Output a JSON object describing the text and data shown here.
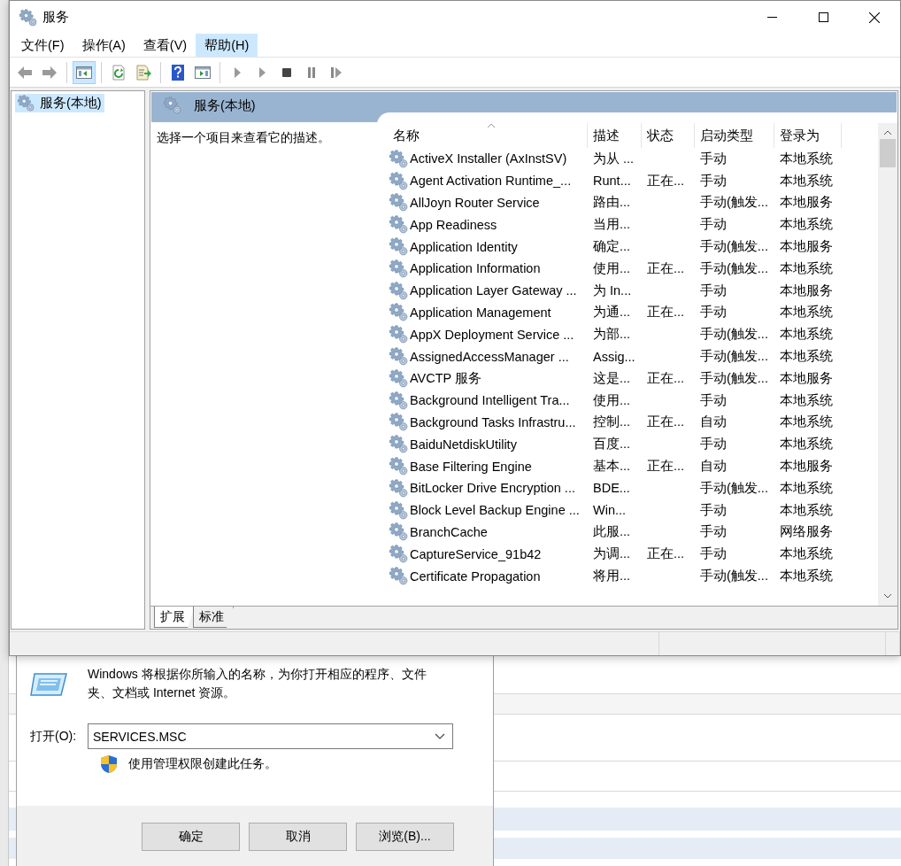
{
  "window": {
    "title": "服务"
  },
  "menu": [
    {
      "label": "文件(F)",
      "selected": false
    },
    {
      "label": "操作(A)",
      "selected": false
    },
    {
      "label": "查看(V)",
      "selected": false
    },
    {
      "label": "帮助(H)",
      "selected": true
    }
  ],
  "toolbar": [
    {
      "kind": "back",
      "selected": false
    },
    {
      "kind": "forward",
      "selected": false
    },
    {
      "kind": "separator"
    },
    {
      "kind": "console_tree",
      "selected": true
    },
    {
      "kind": "separator"
    },
    {
      "kind": "refresh",
      "selected": false
    },
    {
      "kind": "export",
      "selected": false
    },
    {
      "kind": "separator"
    },
    {
      "kind": "help",
      "selected": false
    },
    {
      "kind": "action_pane",
      "selected": false
    },
    {
      "kind": "separator"
    },
    {
      "kind": "start",
      "selected": false
    },
    {
      "kind": "start",
      "selected": false
    },
    {
      "kind": "stop",
      "selected": false
    },
    {
      "kind": "pause",
      "selected": false
    },
    {
      "kind": "restart",
      "selected": false
    }
  ],
  "tree": [
    {
      "label": "服务(本地)",
      "selected": true
    }
  ],
  "panel": {
    "title": "服务(本地)",
    "description": "选择一个项目来查看它的描述。"
  },
  "table": {
    "columns": [
      {
        "label": "名称",
        "sorted": true
      },
      {
        "label": "描述",
        "sorted": false
      },
      {
        "label": "状态",
        "sorted": false
      },
      {
        "label": "启动类型",
        "sorted": false
      },
      {
        "label": "登录为",
        "sorted": false
      }
    ],
    "rows": [
      {
        "name": "ActiveX Installer (AxInstSV)",
        "description": "为从 ...",
        "status": "",
        "startup_type": "手动",
        "log_on_as": "本地系统"
      },
      {
        "name": "Agent Activation Runtime_...",
        "description": "Runt...",
        "status": "正在...",
        "startup_type": "手动",
        "log_on_as": "本地系统"
      },
      {
        "name": "AllJoyn Router Service",
        "description": "路由...",
        "status": "",
        "startup_type": "手动(触发...",
        "log_on_as": "本地服务"
      },
      {
        "name": "App Readiness",
        "description": "当用...",
        "status": "",
        "startup_type": "手动",
        "log_on_as": "本地系统"
      },
      {
        "name": "Application Identity",
        "description": "确定...",
        "status": "",
        "startup_type": "手动(触发...",
        "log_on_as": "本地服务"
      },
      {
        "name": "Application Information",
        "description": "使用...",
        "status": "正在...",
        "startup_type": "手动(触发...",
        "log_on_as": "本地系统"
      },
      {
        "name": "Application Layer Gateway ...",
        "description": "为 In...",
        "status": "",
        "startup_type": "手动",
        "log_on_as": "本地服务"
      },
      {
        "name": "Application Management",
        "description": "为通...",
        "status": "正在...",
        "startup_type": "手动",
        "log_on_as": "本地系统"
      },
      {
        "name": "AppX Deployment Service ...",
        "description": "为部...",
        "status": "",
        "startup_type": "手动(触发...",
        "log_on_as": "本地系统"
      },
      {
        "name": "AssignedAccessManager ...",
        "description": "Assig...",
        "status": "",
        "startup_type": "手动(触发...",
        "log_on_as": "本地系统"
      },
      {
        "name": "AVCTP 服务",
        "description": "这是...",
        "status": "正在...",
        "startup_type": "手动(触发...",
        "log_on_as": "本地服务"
      },
      {
        "name": "Background Intelligent Tra...",
        "description": "使用...",
        "status": "",
        "startup_type": "手动",
        "log_on_as": "本地系统"
      },
      {
        "name": "Background Tasks Infrastru...",
        "description": "控制...",
        "status": "正在...",
        "startup_type": "自动",
        "log_on_as": "本地系统"
      },
      {
        "name": "BaiduNetdiskUtility",
        "description": "百度...",
        "status": "",
        "startup_type": "手动",
        "log_on_as": "本地系统"
      },
      {
        "name": "Base Filtering Engine",
        "description": "基本...",
        "status": "正在...",
        "startup_type": "自动",
        "log_on_as": "本地服务"
      },
      {
        "name": "BitLocker Drive Encryption ...",
        "description": "BDE...",
        "status": "",
        "startup_type": "手动(触发...",
        "log_on_as": "本地系统"
      },
      {
        "name": "Block Level Backup Engine ...",
        "description": "Win...",
        "status": "",
        "startup_type": "手动",
        "log_on_as": "本地系统"
      },
      {
        "name": "BranchCache",
        "description": "此服...",
        "status": "",
        "startup_type": "手动",
        "log_on_as": "网络服务"
      },
      {
        "name": "CaptureService_91b42",
        "description": "为调...",
        "status": "正在...",
        "startup_type": "手动",
        "log_on_as": "本地系统"
      },
      {
        "name": "Certificate Propagation",
        "description": "将用...",
        "status": "",
        "startup_type": "手动(触发...",
        "log_on_as": "本地系统"
      }
    ]
  },
  "view_tabs": [
    {
      "label": "扩展",
      "selected": true
    },
    {
      "label": "标准",
      "selected": false
    }
  ],
  "run_dialog": {
    "message": "Windows 将根据你所输入的名称，为你打开相应的程序、文件夹、文档或 Internet 资源。",
    "open_label": "打开(O):",
    "open_value": "SERVICES.MSC",
    "admin_note": "使用管理权限创建此任务。",
    "buttons": [
      "确定",
      "取消",
      "浏览(B)..."
    ]
  }
}
